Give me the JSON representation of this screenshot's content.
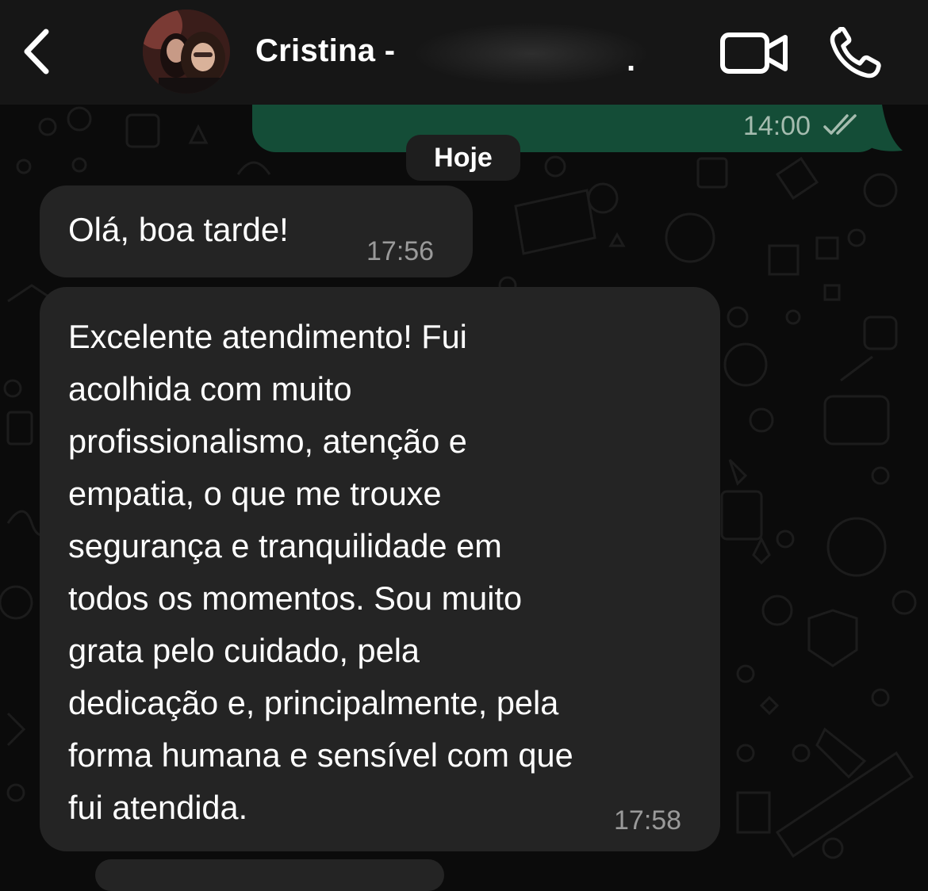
{
  "header": {
    "contact_name": "Cristina -",
    "name_suffix": "."
  },
  "conversation": {
    "outgoing_time": "14:00",
    "date_separator": "Hoje",
    "messages": [
      {
        "text": "Olá, boa tarde!",
        "time": "17:56"
      },
      {
        "lines": [
          "Excelente atendimento! Fui",
          "acolhida com muito",
          "profissionalismo, atenção e",
          "empatia, o que me trouxe",
          "segurança e tranquilidade em",
          "todos os momentos. Sou muito",
          "grata pelo cuidado, pela",
          "dedicação e, principalmente, pela",
          "forma humana e sensível com que",
          "fui atendida."
        ],
        "time": "17:58"
      }
    ]
  },
  "colors": {
    "header_bg": "#161616",
    "outgoing_bubble": "#144d37",
    "incoming_bubble": "#242424",
    "wallpaper": "#0b0b0b"
  },
  "icons": [
    "chevron-left-icon",
    "video-call-icon",
    "phone-call-icon",
    "double-check-icon"
  ]
}
